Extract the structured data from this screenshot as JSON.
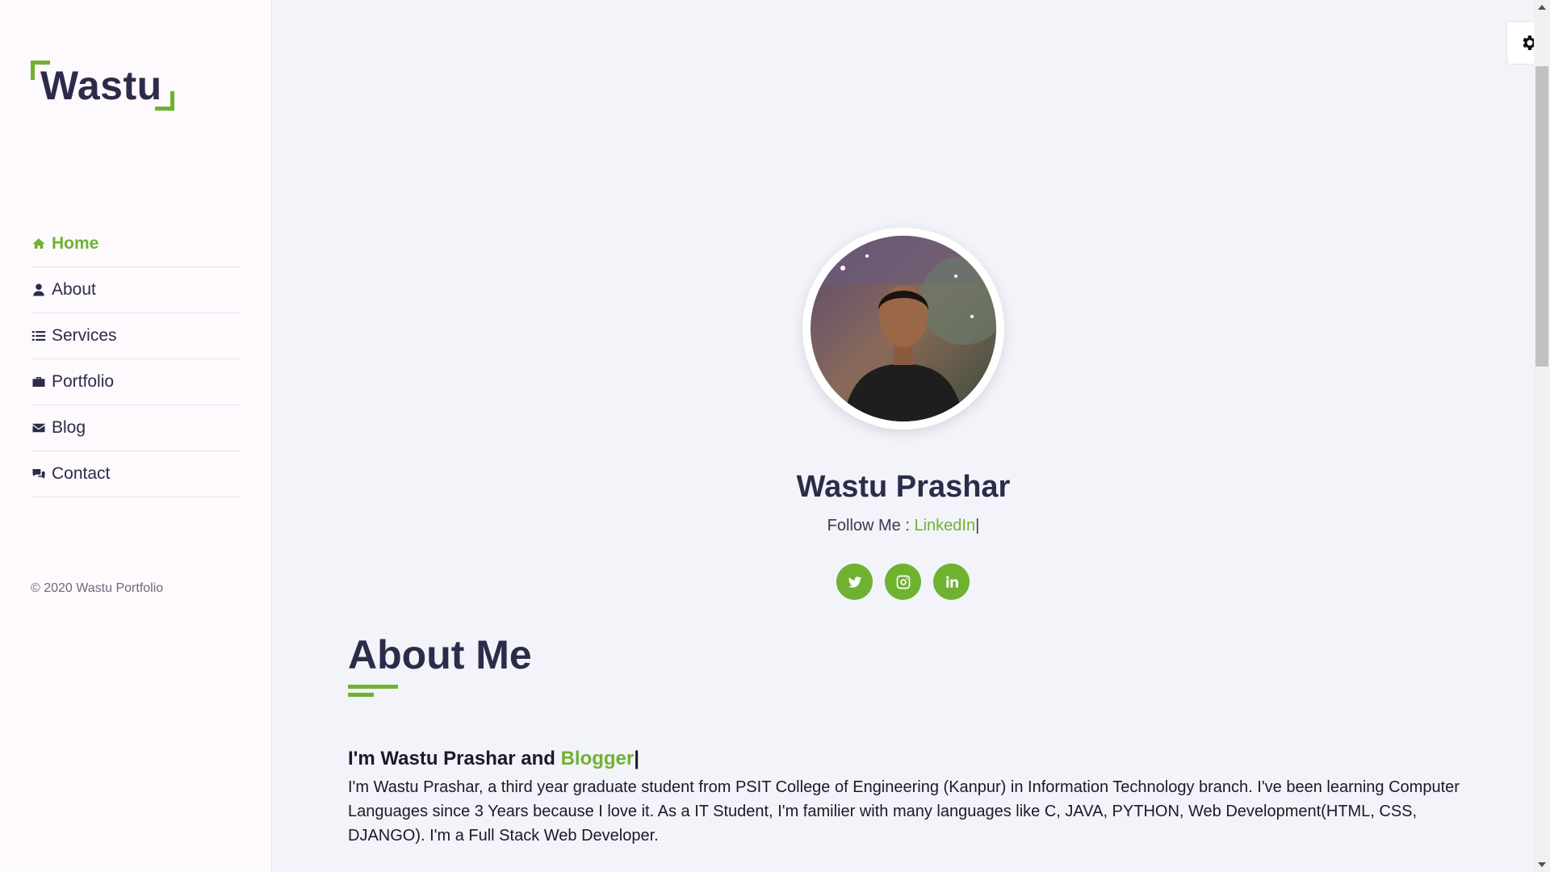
{
  "brand": {
    "name": "Wastu",
    "accent": "#6fb230",
    "text_color": "#2c2c4a"
  },
  "nav": {
    "items": [
      {
        "label": "Home",
        "icon": "home-icon",
        "active": true
      },
      {
        "label": "About",
        "icon": "user-icon",
        "active": false
      },
      {
        "label": "Services",
        "icon": "list-icon",
        "active": false
      },
      {
        "label": "Portfolio",
        "icon": "briefcase-icon",
        "active": false
      },
      {
        "label": "Blog",
        "icon": "envelope-icon",
        "active": false
      },
      {
        "label": "Contact",
        "icon": "comments-icon",
        "active": false
      }
    ]
  },
  "footer": {
    "copyright": "© 2020 Wastu Portfolio"
  },
  "hero": {
    "name": "Wastu Prashar",
    "follow_prefix": "Follow Me : ",
    "follow_link": "LinkedIn",
    "cursor": "|",
    "social": [
      "twitter-icon",
      "instagram-icon",
      "linkedin-icon"
    ]
  },
  "about": {
    "title": "About Me",
    "intro_prefix": "I'm Wastu Prashar and ",
    "intro_role": "Blogger",
    "cursor": "|",
    "bio": "I'm Wastu Prashar, a third year graduate student from PSIT College of Engineering (Kanpur) in Information Technology branch. I've been learning Computer Languages since 3 Years because I love it. As a IT Student, I'm familier with many languages like C, JAVA, PYTHON, Web Development(HTML, CSS, DJANGO). I'm a Full Stack Web Developer."
  },
  "settings": {
    "icon": "gear-icon"
  }
}
